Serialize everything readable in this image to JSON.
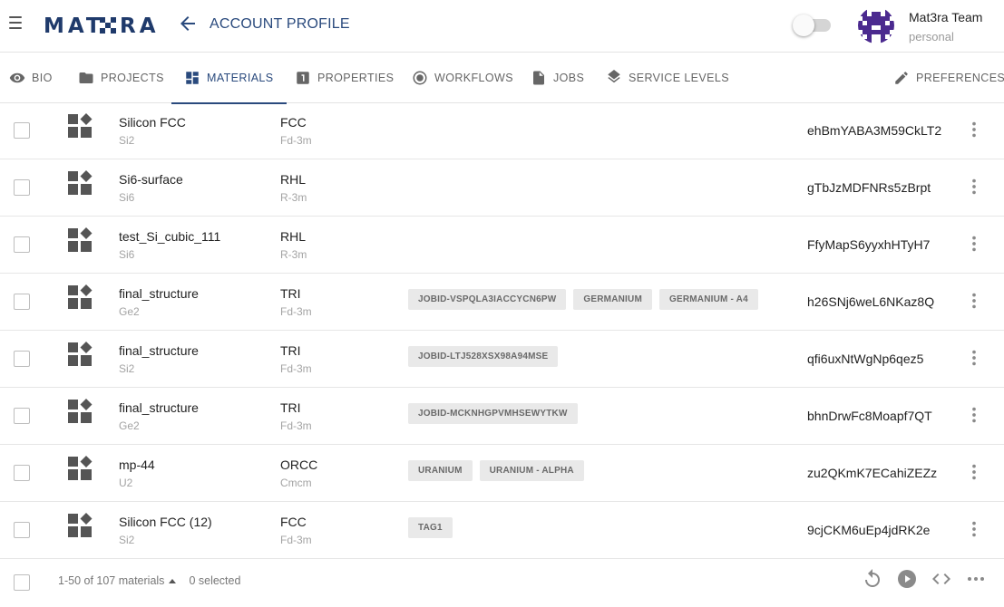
{
  "header": {
    "logo_text": "MATERA",
    "title": "ACCOUNT PROFILE",
    "user_name": "Mat3ra Team",
    "user_sub": "personal",
    "toggle_on": false,
    "menu_icon": "hamburger-icon",
    "back_icon": "arrow-left-icon",
    "brand_color": "#1f3a6b"
  },
  "tabs": [
    {
      "label": "BIO",
      "icon": "eye-icon",
      "active": false
    },
    {
      "label": "PROJECTS",
      "icon": "folder-icon",
      "active": false
    },
    {
      "label": "MATERIALS",
      "icon": "dashboard-icon",
      "active": true
    },
    {
      "label": "PROPERTIES",
      "icon": "numbered-box-icon",
      "active": false
    },
    {
      "label": "WORKFLOWS",
      "icon": "radio-circle-icon",
      "active": false
    },
    {
      "label": "JOBS",
      "icon": "file-icon",
      "active": false
    },
    {
      "label": "SERVICE LEVELS",
      "icon": "layers-icon",
      "active": false
    },
    {
      "label": "PREFERENCES",
      "icon": "pencil-icon",
      "active": false
    }
  ],
  "materials": [
    {
      "name": "Silicon FCC",
      "formula": "Si2",
      "lattice": "FCC",
      "space_group": "Fd-3m",
      "tags": [],
      "id": "ehBmYABA3M59CkLT2"
    },
    {
      "name": "Si6-surface",
      "formula": "Si6",
      "lattice": "RHL",
      "space_group": "R-3m",
      "tags": [],
      "id": "gTbJzMDFNRs5zBrpt"
    },
    {
      "name": "test_Si_cubic_111",
      "formula": "Si6",
      "lattice": "RHL",
      "space_group": "R-3m",
      "tags": [],
      "id": "FfyMapS6yyxhHTyH7"
    },
    {
      "name": "final_structure",
      "formula": "Ge2",
      "lattice": "TRI",
      "space_group": "Fd-3m",
      "tags": [
        "JOBID-VSPQLA3IACCYCN6PW",
        "GERMANIUM",
        "GERMANIUM - A4"
      ],
      "id": "h26SNj6weL6NKaz8Q"
    },
    {
      "name": "final_structure",
      "formula": "Si2",
      "lattice": "TRI",
      "space_group": "Fd-3m",
      "tags": [
        "JOBID-LTJ528XSX98A94MSE"
      ],
      "id": "qfi6uxNtWgNp6qez5"
    },
    {
      "name": "final_structure",
      "formula": "Ge2",
      "lattice": "TRI",
      "space_group": "Fd-3m",
      "tags": [
        "JOBID-MCKNHGPVMHSEWYTKW"
      ],
      "id": "bhnDrwFc8Moapf7QT"
    },
    {
      "name": "mp-44",
      "formula": "U2",
      "lattice": "ORCC",
      "space_group": "Cmcm",
      "tags": [
        "URANIUM",
        "URANIUM - ALPHA"
      ],
      "id": "zu2QKmK7ECahiZEZz"
    },
    {
      "name": "Silicon FCC (12)",
      "formula": "Si2",
      "lattice": "FCC",
      "space_group": "Fd-3m",
      "tags": [
        "TAG1"
      ],
      "id": "9cjCKM6uEp4jdRK2e"
    }
  ],
  "footer": {
    "pagination": "1-50 of 107 materials",
    "selected": "0 selected",
    "actions": [
      "refresh-icon",
      "play-circle-icon",
      "code-icon",
      "more-horizontal-icon"
    ]
  }
}
